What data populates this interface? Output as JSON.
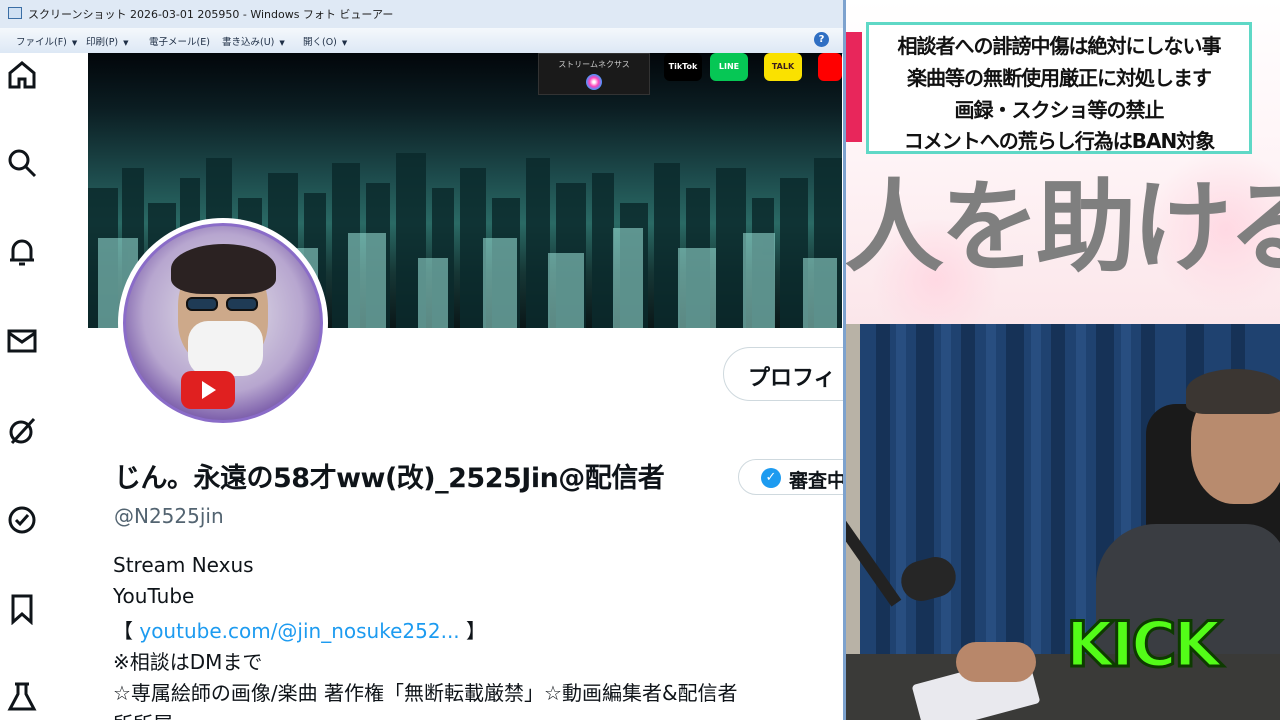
{
  "viewer": {
    "title": "スクリーンショット 2026-03-01 205950 - Windows フォト ビューアー",
    "menus": [
      "ファイル(F)",
      "印刷(P)",
      "電子メール(E)",
      "書き込み(U)",
      "開く(O)"
    ],
    "help": "?"
  },
  "profile": {
    "banner_box_text": "ストリームネクサス",
    "sns_tiktok": "TikTok",
    "sns_line": "LINE",
    "sns_talk": "TALK",
    "edit_button": "プロフィ",
    "display_name": "じん。永遠の58才ww(改)_2525Jin@配信者",
    "verify_label": "審査中",
    "verify_check": "✓",
    "handle": "@N2525jin",
    "bio": {
      "line1": "Stream Nexus",
      "line2": "YouTube",
      "line3_open": "【 ",
      "line3_link": "youtube.com/@jin_nosuke252...",
      "line3_close": " 】",
      "line4": "※相談はDMまで",
      "line5": "☆専属絵師の画像/楽曲 著作権「無断転載厳禁」☆動画編集者&配信者",
      "line6": "所所属"
    }
  },
  "overlay": {
    "rules": [
      "相談者への誹謗中傷は絶対にしない事",
      "楽曲等の無断使用厳正に対処します",
      "画録・スクショ等の禁止",
      "コメントへの荒らし行為はBAN対象"
    ],
    "big_text": "人を助ける",
    "kick_logo": "KICK"
  },
  "colors": {
    "accent_blue": "#1d9bf0",
    "kick_green": "#53fc18",
    "rule_border": "#5fd8c6",
    "pink_tab": "#e8265b"
  }
}
